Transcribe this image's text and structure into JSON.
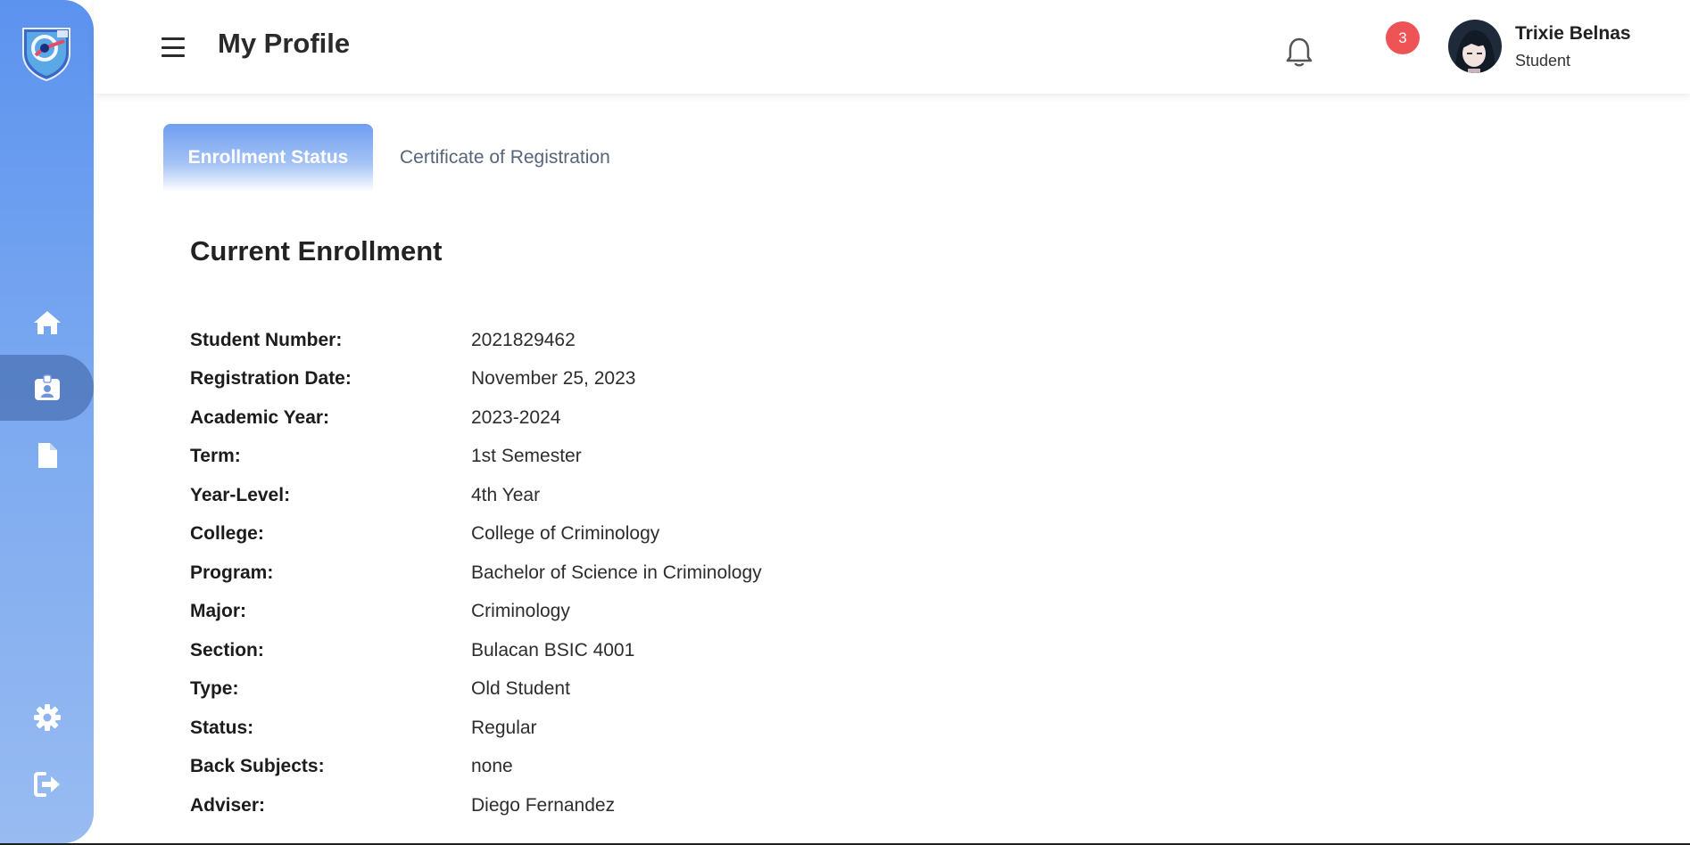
{
  "header": {
    "page_title": "My Profile",
    "notification_count": "3",
    "user": {
      "name": "Trixie Belnas",
      "role": "Student"
    }
  },
  "sidebar": {
    "items": [
      {
        "icon": "home-icon"
      },
      {
        "icon": "id-badge-icon",
        "active": true
      },
      {
        "icon": "file-icon"
      },
      {
        "icon": "gear-icon"
      },
      {
        "icon": "logout-icon"
      }
    ]
  },
  "tabs": [
    {
      "label": "Enrollment Status",
      "active": true
    },
    {
      "label": "Certificate of Registration",
      "active": false
    }
  ],
  "enrollment": {
    "title": "Current Enrollment",
    "fields": [
      {
        "label": "Student Number:",
        "value": "2021829462"
      },
      {
        "label": "Registration Date:",
        "value": "November 25, 2023"
      },
      {
        "label": "Academic Year:",
        "value": "2023-2024"
      },
      {
        "label": "Term:",
        "value": "1st Semester"
      },
      {
        "label": "Year-Level:",
        "value": "4th Year"
      },
      {
        "label": "College:",
        "value": "College of Criminology"
      },
      {
        "label": "Program:",
        "value": "Bachelor of Science in Criminology"
      },
      {
        "label": "Major:",
        "value": "Criminology"
      },
      {
        "label": "Section:",
        "value": "Bulacan BSIC 4001"
      },
      {
        "label": "Type:",
        "value": "Old Student"
      },
      {
        "label": "Status:",
        "value": "Regular"
      },
      {
        "label": "Back Subjects:",
        "value": "none"
      },
      {
        "label": "Adviser:",
        "value": "Diego Fernandez"
      }
    ]
  },
  "colors": {
    "sidebar_top": "#5c93ef",
    "sidebar_bottom": "#98bbf1",
    "badge": "#ee5355",
    "active_tab": "#6f9ff1"
  }
}
